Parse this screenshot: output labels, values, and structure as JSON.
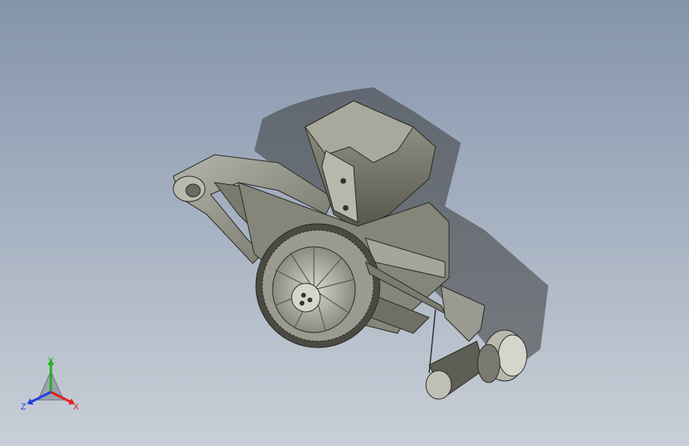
{
  "viewport": {
    "background_top": "#8494ab",
    "background_bottom": "#c9cfd7",
    "model_color": "#8a8a80",
    "shadow_color": "#3a3a3a"
  },
  "triad": {
    "x_label": "X",
    "y_label": "Y",
    "z_label": "Z",
    "x_color": "#e02020",
    "y_color": "#20b020",
    "z_color": "#2040e0"
  }
}
